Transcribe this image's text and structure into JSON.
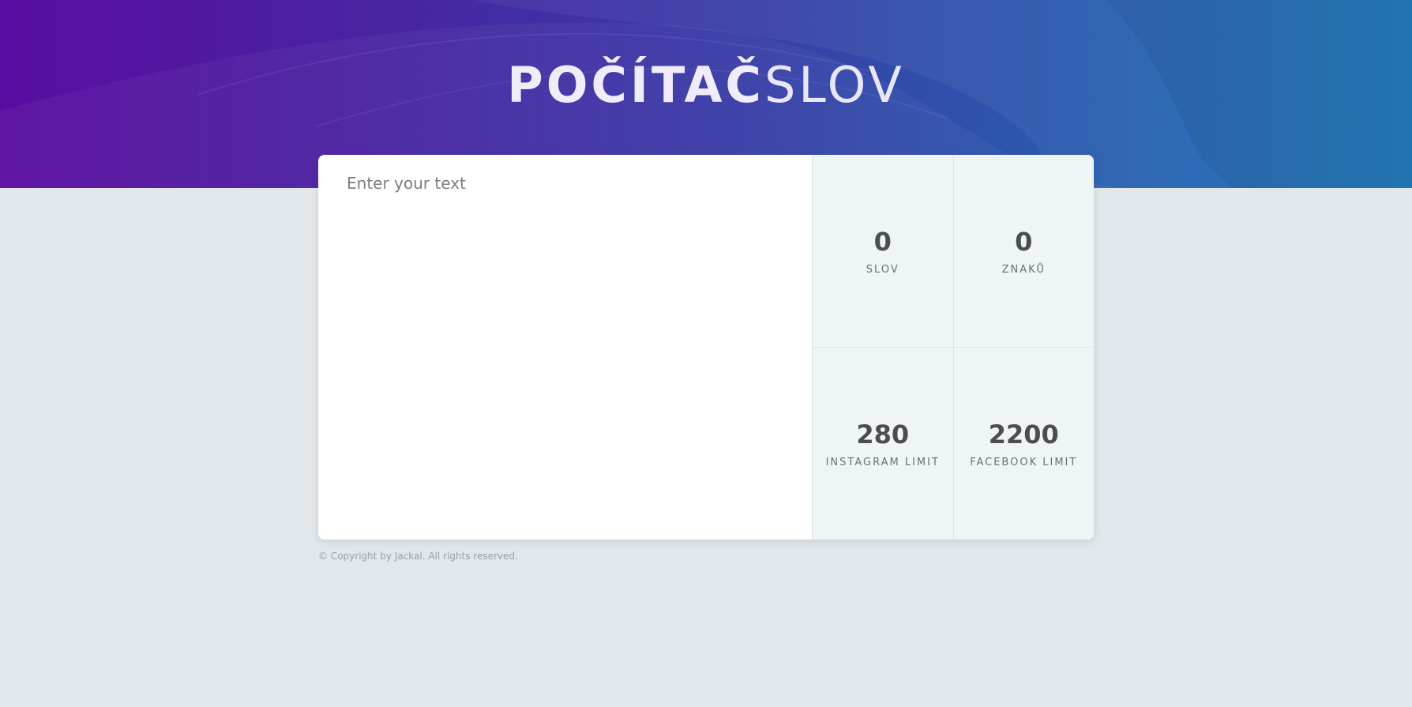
{
  "header": {
    "title_bold": "POČÍTAČ",
    "title_light": "SLOV"
  },
  "editor": {
    "placeholder": "Enter your text",
    "value": ""
  },
  "stats": [
    {
      "value": "0",
      "label": "SLOV"
    },
    {
      "value": "0",
      "label": "ZNAKŮ"
    },
    {
      "value": "280",
      "label": "INSTAGRAM LIMIT"
    },
    {
      "value": "2200",
      "label": "FACEBOOK LIMIT"
    }
  ],
  "footer": {
    "copyright": "© Copyright by Jackal. All rights reserved."
  },
  "colors": {
    "gradient_start": "#5a0ca0",
    "gradient_end": "#1874b8",
    "background": "#e1e7ea",
    "stat_panel": "#eff4f6"
  }
}
